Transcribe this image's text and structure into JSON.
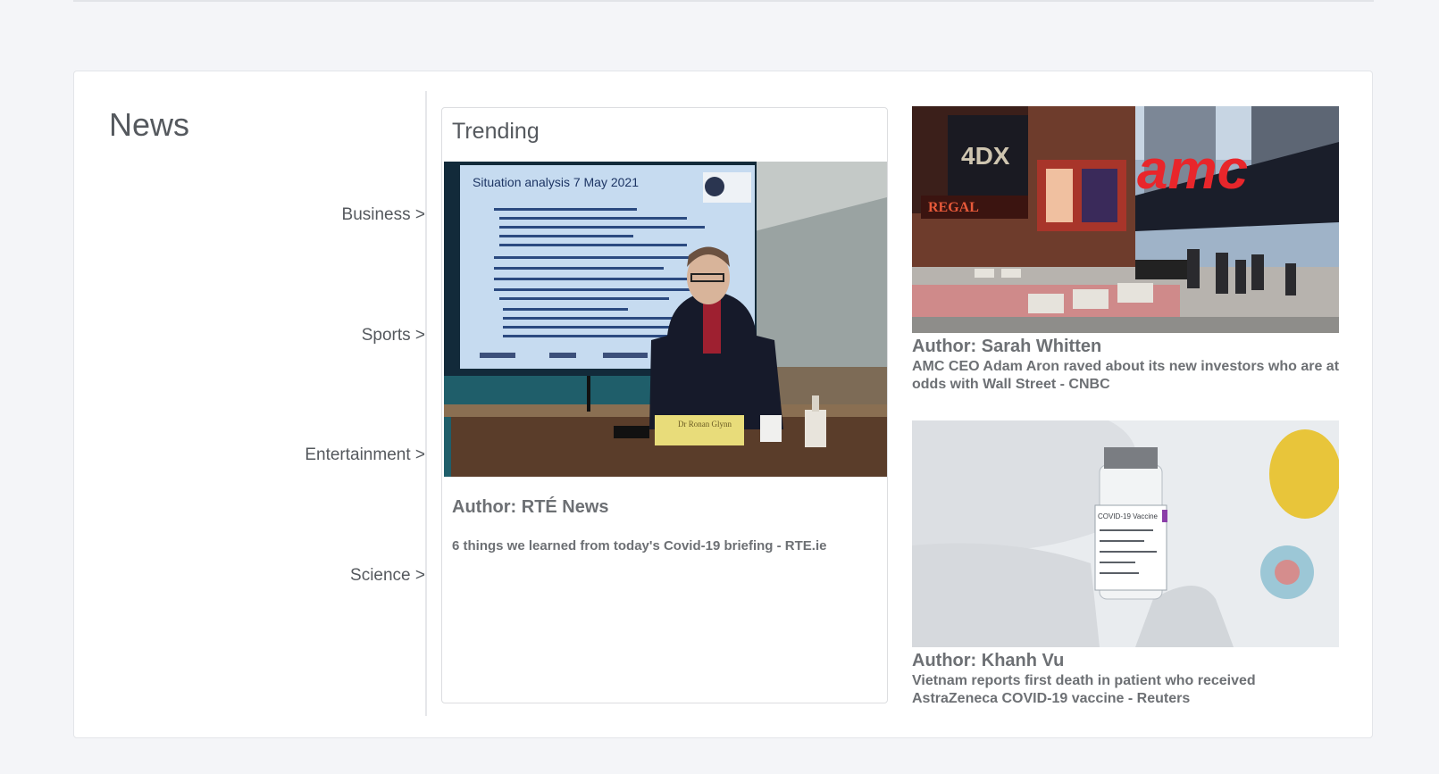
{
  "news": {
    "title": "News",
    "categories": [
      {
        "label": "Business >"
      },
      {
        "label": "Sports >"
      },
      {
        "label": "Entertainment >"
      },
      {
        "label": "Science >"
      }
    ],
    "trending": {
      "title": "Trending",
      "image_text": {
        "slide_title": "Situation analysis 7 May 2021",
        "nameplate": "Dr Ronan Glynn"
      },
      "author": "Author: RTÉ News",
      "headline": "6 things we learned from today's Covid-19 briefing - RTE.ie"
    },
    "stories": [
      {
        "author": "Author: Sarah Whitten",
        "headline": "AMC CEO Adam Aron raved about its new investors who are at odds with Wall Street - CNBC",
        "image_text": {
          "sign": "amc",
          "regal": "REGAL"
        }
      },
      {
        "author": "Author: Khanh Vu",
        "headline": "Vietnam reports first death in patient who received AstraZeneca COVID-19 vaccine - Reuters",
        "image_text": {
          "vial_label": "COVID-19 Vaccine"
        }
      }
    ]
  },
  "colors": {
    "background": "#f4f5f8",
    "card": "#ffffff",
    "text": "#55595e",
    "subtext": "#6d7074",
    "amc_red": "#e8262b"
  }
}
